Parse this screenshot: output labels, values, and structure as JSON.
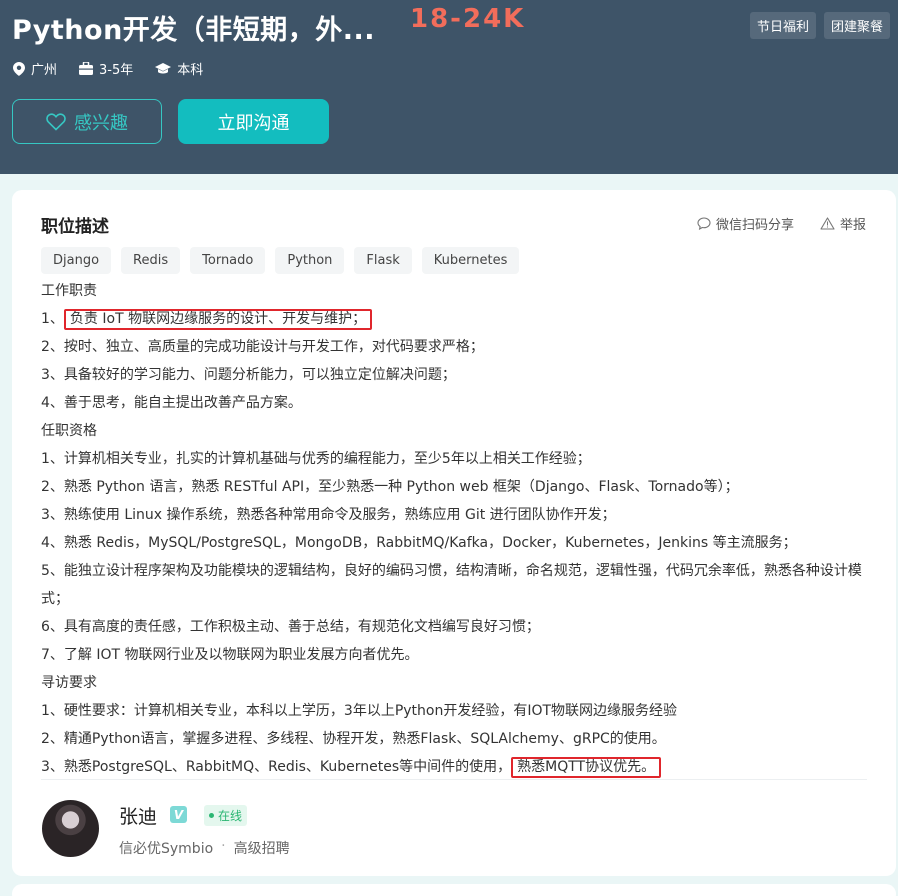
{
  "header": {
    "job_title": "Python开发（非短期，外...",
    "salary": "18-24K",
    "benefits": [
      "节日福利",
      "团建聚餐"
    ],
    "meta": {
      "location": "广州",
      "experience": "3-5年",
      "education": "本科"
    },
    "interest_label": "感兴趣",
    "chat_label": "立即沟通"
  },
  "card": {
    "title": "职位描述",
    "share_label": "微信扫码分享",
    "report_label": "举报",
    "skills": [
      "Django",
      "Redis",
      "Tornado",
      "Python",
      "Flask",
      "Kubernetes"
    ],
    "lines": {
      "l0": "工作职责",
      "l1_prefix": "1、",
      "l1_highlight": "负责 IoT 物联网边缘服务的设计、开发与维护；",
      "l2": "2、按时、独立、高质量的完成功能设计与开发工作，对代码要求严格；",
      "l3": "3、具备较好的学习能力、问题分析能力，可以独立定位解决问题；",
      "l4": "4、善于思考，能自主提出改善产品方案。",
      "l5": "任职资格",
      "l6": "1、计算机相关专业，扎实的计算机基础与优秀的编程能力，至少5年以上相关工作经验；",
      "l7": "2、熟悉 Python 语言，熟悉 RESTful API，至少熟悉一种 Python web 框架（Django、Flask、Tornado等）；",
      "l8": "3、熟练使用 Linux 操作系统，熟悉各种常用命令及服务，熟练应用 Git 进行团队协作开发；",
      "l9": "4、熟悉 Redis，MySQL/PostgreSQL，MongoDB，RabbitMQ/Kafka，Docker，Kubernetes，Jenkins 等主流服务；",
      "l10": "5、能独立设计程序架构及功能模块的逻辑结构，良好的编码习惯，结构清晰，命名规范，逻辑性强，代码冗余率低，熟悉各种设计模式；",
      "l11": "6、具有高度的责任感，工作积极主动、善于总结，有规范化文档编写良好习惯；",
      "l12": "7、了解 IOT 物联网行业及以物联网为职业发展方向者优先。",
      "l13": "寻访要求",
      "l14": "1、硬性要求：计算机相关专业，本科以上学历，3年以上Python开发经验，有IOT物联网边缘服务经验",
      "l15": "2、精通Python语言，掌握多进程、多线程、协程开发，熟悉Flask、SQLAlchemy、gRPC的使用。",
      "l16_prefix": "3、熟悉PostgreSQL、RabbitMQ、Redis、Kubernetes等中间件的使用，",
      "l16_highlight": "熟悉MQTT协议优先。"
    },
    "recruiter": {
      "name": "张迪",
      "verified_mark": "V",
      "status": "在线",
      "company": "信必优Symbio",
      "separator": "·",
      "position": "高级招聘"
    }
  },
  "colors": {
    "header_bg": "#3e5468",
    "salary": "#f26d5b",
    "accent": "#13bdbf",
    "highlight_border": "#e0262c"
  }
}
